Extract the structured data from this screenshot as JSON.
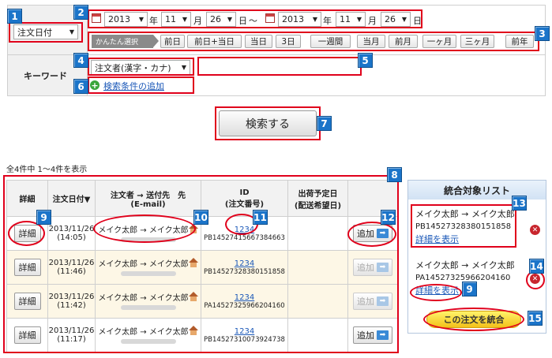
{
  "search": {
    "date_type_select": "注文日付",
    "date_from": {
      "year": "2013",
      "year_unit": "年",
      "month": "11",
      "month_unit": "月",
      "day": "26",
      "day_unit": "日"
    },
    "date_sep": "～",
    "date_to": {
      "year": "2013",
      "year_unit": "年",
      "month": "11",
      "month_unit": "月",
      "day": "26",
      "day_unit": "日"
    },
    "quick_label": "かんたん選択",
    "quick_buttons": [
      "前日",
      "前日+当日",
      "当日",
      "3日",
      "一週間",
      "当月",
      "前月",
      "一ヶ月",
      "三ヶ月",
      "前年"
    ],
    "keyword_label": "キーワード",
    "keyword_select": "注文者(漢字・カナ)",
    "keyword_value": "",
    "add_condition_link": "検索条件の追加"
  },
  "search_button": "検索する",
  "result_count": "全4件中 1～4件を表示",
  "table": {
    "headers": {
      "detail": "詳細",
      "order_date": "注文日付▼",
      "orderer_line1": "注文者 → 送付先　先",
      "orderer_line2": "(E-mail)",
      "id_line1": "ID",
      "id_line2": "(注文番号)",
      "ship_line1": "出荷予定日",
      "ship_line2": "(配送希望日)"
    },
    "rows": [
      {
        "detail": "詳細",
        "date": "2013/11/26",
        "time": "(14:05)",
        "names": "メイク太郎 → メイク太郎",
        "id": "1234",
        "order_no": "PB14527415667384663",
        "add": "追加"
      },
      {
        "detail": "詳細",
        "date": "2013/11/26",
        "time": "(11:46)",
        "names": "メイク太郎 → メイク太郎",
        "id": "1234",
        "order_no": "PB14527328380151858",
        "add": "追加"
      },
      {
        "detail": "詳細",
        "date": "2013/11/26",
        "time": "(11:42)",
        "names": "メイク太郎 → メイク太郎",
        "id": "1234",
        "order_no": "PA14527325966204160",
        "add": "追加"
      },
      {
        "detail": "詳細",
        "date": "2013/11/26",
        "time": "(11:17)",
        "names": "メイク太郎 → メイク太郎",
        "id": "1234",
        "order_no": "PB14527310073924738",
        "add": "追加"
      }
    ]
  },
  "merge_panel": {
    "title": "統合対象リスト",
    "items": [
      {
        "names": "メイク太郎 → メイク太郎",
        "order_no": "PB14527328380151858",
        "link": "詳細を表示"
      },
      {
        "names": "メイク太郎 → メイク太郎",
        "order_no": "PA14527325966204160",
        "link": "詳細を表示"
      }
    ],
    "merge_button": "この注文を統合"
  },
  "badges": [
    "1",
    "2",
    "3",
    "4",
    "5",
    "6",
    "7",
    "8",
    "9",
    "10",
    "11",
    "12",
    "13",
    "14",
    "15",
    "9"
  ],
  "colors": {
    "callout_red": "#e0001b",
    "badge_blue": "#1b74c9",
    "row_yellow": "#fdf7e6",
    "merge_yellow": "#f3c11a"
  }
}
